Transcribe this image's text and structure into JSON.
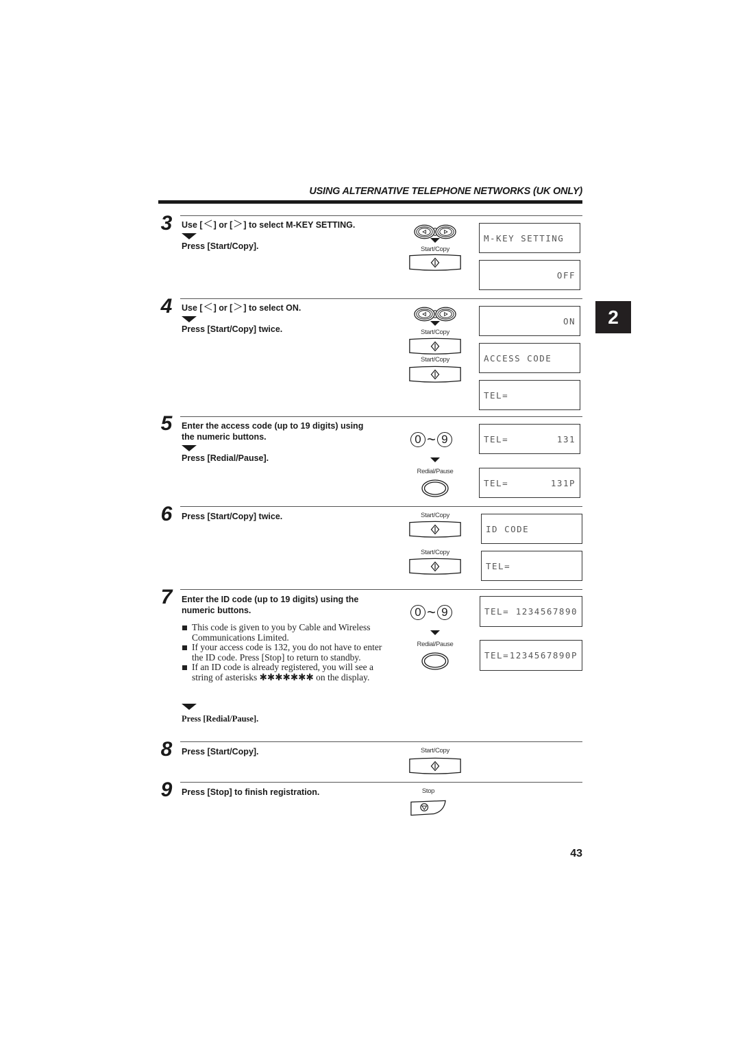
{
  "header": {
    "title": "USING ALTERNATIVE TELEPHONE NETWORKS (UK ONLY)"
  },
  "side_tab": {
    "chapter": "2"
  },
  "page_number": "43",
  "icons": {
    "left_right_keys": "left-right-arrow-keys-icon",
    "start_copy": "start-copy-diamond-icon",
    "redial_pause": "redial-pause-oval-icon",
    "stop": "stop-icon",
    "numeric": "numeric-keys-0-9-icon",
    "flow_arrow": "down-triangle-icon"
  },
  "buttons": {
    "start_copy": "Start/Copy",
    "redial_pause": "Redial/Pause",
    "stop": "Stop",
    "numeric_from": "0",
    "numeric_tilde": "~",
    "numeric_to": "9"
  },
  "steps": [
    {
      "number": "3",
      "instruction_pre": "Use [",
      "instruction_mid": "] or [",
      "instruction_post": "] to select M-KEY SETTING.",
      "action": "Press [Start/Copy].",
      "displays": [
        {
          "left": "M-KEY SETTING",
          "right": ""
        },
        {
          "left": "",
          "right": "OFF"
        }
      ]
    },
    {
      "number": "4",
      "instruction_pre": "Use [",
      "instruction_mid": "] or [",
      "instruction_post": "] to select ON.",
      "action": "Press [Start/Copy] twice.",
      "displays": [
        {
          "left": "",
          "right": "ON"
        },
        {
          "left": "ACCESS CODE",
          "right": ""
        },
        {
          "left": "TEL=",
          "right": ""
        }
      ]
    },
    {
      "number": "5",
      "instruction_line1": "Enter the access code (up to 19 digits) using",
      "instruction_line2": "the numeric buttons.",
      "action": "Press [Redial/Pause].",
      "displays": [
        {
          "left": "TEL=",
          "right": "131"
        },
        {
          "left": "TEL=",
          "right": "131P"
        }
      ]
    },
    {
      "number": "6",
      "action": "Press [Start/Copy] twice.",
      "displays": [
        {
          "left": "ID CODE",
          "right": ""
        },
        {
          "left": "TEL=",
          "right": ""
        }
      ]
    },
    {
      "number": "7",
      "instruction_line1": "Enter the ID code (up to 19 digits) using the",
      "instruction_line2": "numeric buttons.",
      "notes": [
        "This code is given to you by Cable and Wireless Communications Limited.",
        "If your access code is 132, you do not have to enter the ID code. Press [Stop] to return to standby.",
        "If an ID code is already registered, you will see a string of asterisks ✱✱✱✱✱✱✱ on the display."
      ],
      "action": "Press [Redial/Pause].",
      "displays": [
        {
          "left": "TEL=",
          "right": "1234567890"
        },
        {
          "left": "TEL=",
          "right": "1234567890P"
        }
      ]
    },
    {
      "number": "8",
      "action": "Press [Start/Copy]."
    },
    {
      "number": "9",
      "action": "Press [Stop] to finish registration."
    }
  ]
}
